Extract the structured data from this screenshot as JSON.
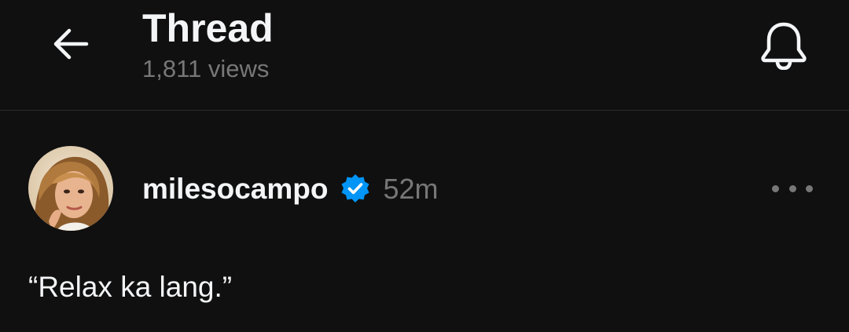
{
  "header": {
    "title": "Thread",
    "views": "1,811 views",
    "back_icon": "arrow-left-icon",
    "notify_icon": "bell-icon"
  },
  "post": {
    "username": "milesocampo",
    "verified_icon": "verified-badge-icon",
    "timestamp": "52m",
    "more_icon": "more-horizontal-icon",
    "text": "“Relax ka lang.”"
  },
  "colors": {
    "background": "#101010",
    "primary_text": "#f3f5f7",
    "secondary_text": "#777777",
    "verified_blue": "#0095f6",
    "divider": "#2a2a2a"
  }
}
